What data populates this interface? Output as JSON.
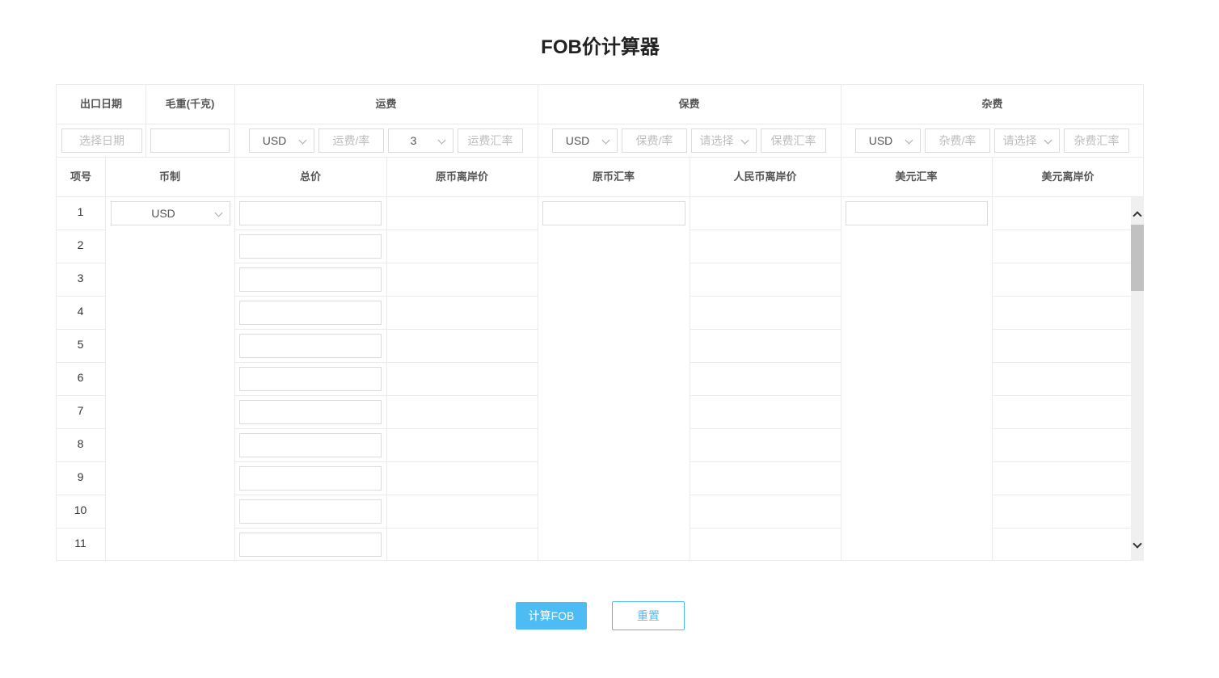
{
  "title": "FOB价计算器",
  "top_headers": {
    "export_date": "出口日期",
    "gross_weight": "毛重(千克)",
    "freight": "运费",
    "insurance": "保费",
    "misc": "杂费"
  },
  "inputs": {
    "date_placeholder": "选择日期",
    "weight_value": "",
    "freight": {
      "currency": "USD",
      "rate_placeholder": "运费/率",
      "mode": "3",
      "fx_placeholder": "运费汇率"
    },
    "insurance": {
      "currency": "USD",
      "rate_placeholder": "保费/率",
      "mode_placeholder": "请选择",
      "fx_placeholder": "保费汇率"
    },
    "misc": {
      "currency": "USD",
      "rate_placeholder": "杂费/率",
      "mode_placeholder": "请选择",
      "fx_placeholder": "杂费汇率"
    }
  },
  "columns": [
    "项号",
    "币制",
    "总价",
    "原币离岸价",
    "原币汇率",
    "人民币离岸价",
    "美元汇率",
    "美元离岸价"
  ],
  "rows": [
    "1",
    "2",
    "3",
    "4",
    "5",
    "6",
    "7",
    "8",
    "9",
    "10",
    "11"
  ],
  "row_currency": "USD",
  "buttons": {
    "calculate": "计算FOB",
    "reset": "重置"
  }
}
